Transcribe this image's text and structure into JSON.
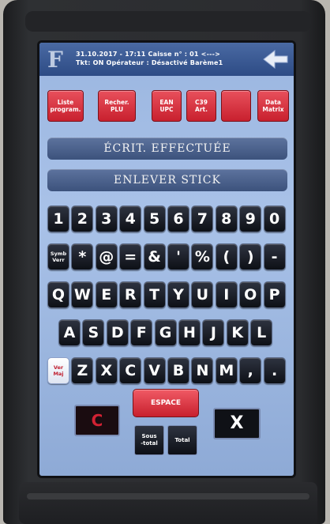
{
  "header": {
    "line1": "31.10.2017 - 17:11   Caisse n° : 01 <--->",
    "line2": "Tkt: ON Opérateur : Désactivé   Barème1",
    "logo": "F"
  },
  "function_keys": [
    {
      "line1": "Liste",
      "line2": "program."
    },
    {
      "line1": "Recher.",
      "line2": "PLU"
    },
    {
      "line1": "EAN",
      "line2": "UPC"
    },
    {
      "line1": "C39",
      "line2": "Art."
    },
    {
      "line1": "",
      "line2": ""
    },
    {
      "line1": "Data",
      "line2": "Matrix"
    }
  ],
  "banners": {
    "status": "ÉCRIT. EFFECTUÉE",
    "instruction": "ENLEVER STICK"
  },
  "keyboard": {
    "row1": [
      "1",
      "2",
      "3",
      "4",
      "5",
      "6",
      "7",
      "8",
      "9",
      "0"
    ],
    "row2": [
      "*",
      "@",
      "=",
      "&",
      "'",
      "%",
      "(",
      ")",
      "-"
    ],
    "symb_line1": "Symb",
    "symb_line2": "Verr",
    "row3": [
      "Q",
      "W",
      "E",
      "R",
      "T",
      "Y",
      "U",
      "I",
      "O",
      "P"
    ],
    "row4": [
      "A",
      "S",
      "D",
      "F",
      "G",
      "H",
      "J",
      "K",
      "L"
    ],
    "shift_line1": "Ver",
    "shift_line2": "Maj",
    "row5": [
      "Z",
      "X",
      "C",
      "V",
      "B",
      "N",
      "M",
      ",",
      "."
    ]
  },
  "controls": {
    "clear": "C",
    "space": "ESPACE",
    "cancel": "X",
    "subtotal_line1": "Sous",
    "subtotal_line2": "-total",
    "total": "Total"
  }
}
